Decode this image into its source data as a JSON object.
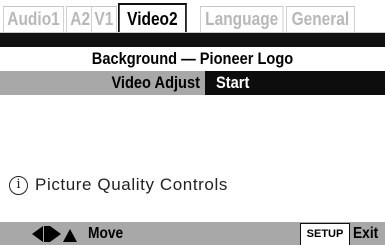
{
  "tabs": [
    {
      "label": "Audio1",
      "active": false
    },
    {
      "label": "A2",
      "active": false
    },
    {
      "label": "V1",
      "active": false
    },
    {
      "label": "Video2",
      "active": true
    },
    {
      "label": "Language",
      "active": false
    },
    {
      "label": "General",
      "active": false
    }
  ],
  "menu": {
    "background_row": "Background — Pioneer Logo",
    "video_adjust": {
      "label": "Video Adjust",
      "value": "Start"
    }
  },
  "info": {
    "icon": "info-icon",
    "glyph": "i",
    "text": "Picture Quality Controls"
  },
  "footer": {
    "navigation_icons": [
      "arrow-left-icon",
      "arrow-right-icon",
      "arrow-up-icon"
    ],
    "move_label": "Move",
    "setup_label": "SETUP",
    "exit_label": "Exit"
  },
  "colors": {
    "highlight_row": "#a8a8a8",
    "selected_value_bg": "#0d0d0d",
    "inactive_tab_text": "#b8b8b8"
  }
}
